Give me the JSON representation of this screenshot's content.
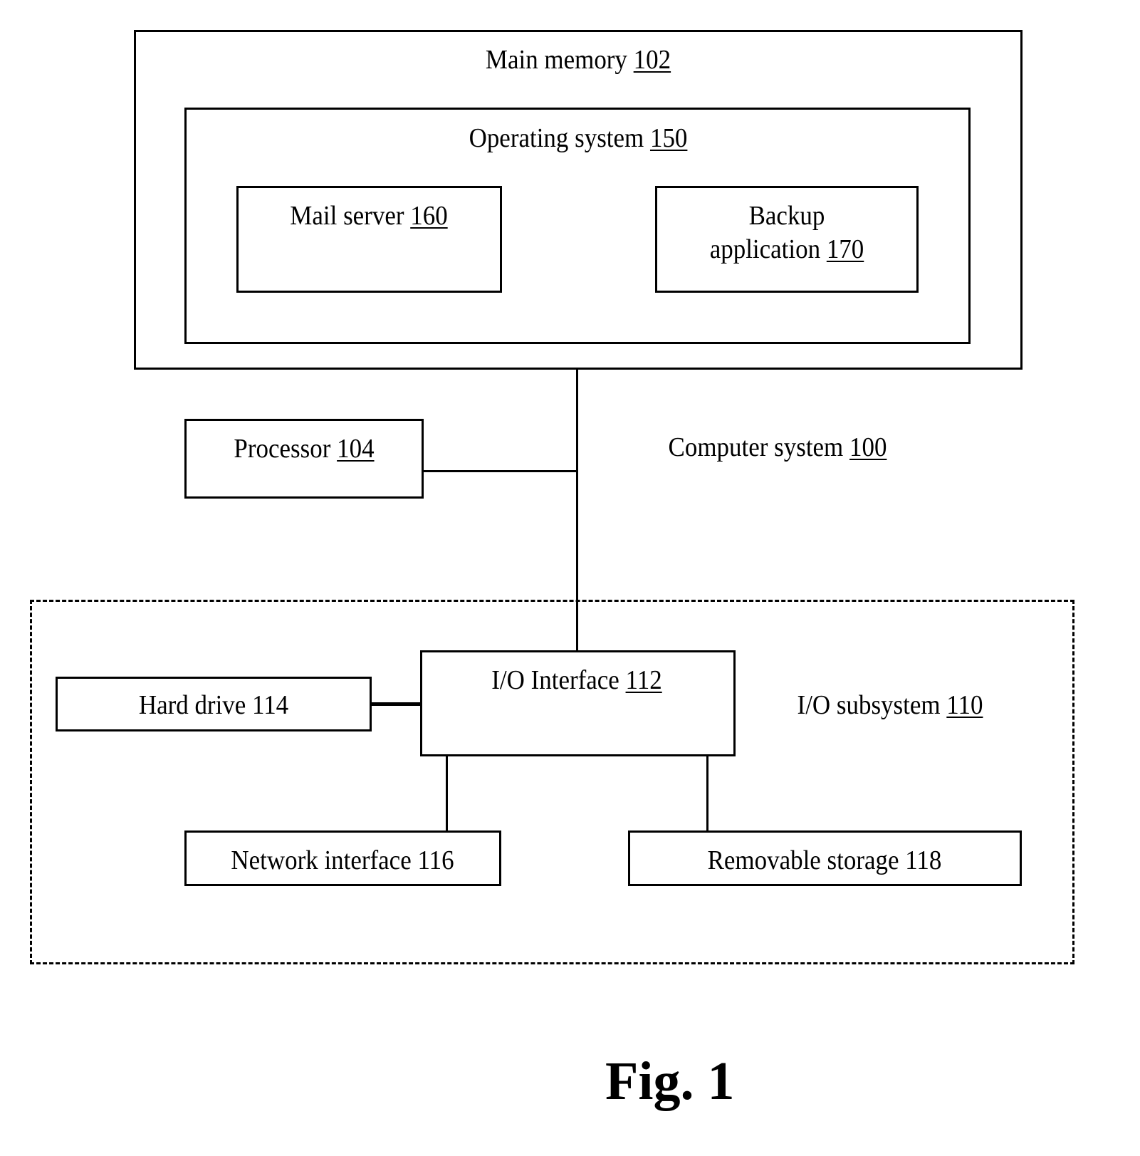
{
  "diagram": {
    "main_memory": {
      "label": "Main memory",
      "ref": "102"
    },
    "operating_system": {
      "label": "Operating system",
      "ref": "150"
    },
    "mail_server": {
      "label": "Mail server",
      "ref": "160"
    },
    "backup_application": {
      "label_line1": "Backup",
      "label_line2": "application",
      "ref": "170"
    },
    "processor": {
      "label": "Processor",
      "ref": "104"
    },
    "computer_system": {
      "label": "Computer system",
      "ref": "100"
    },
    "io_subsystem": {
      "label": "I/O subsystem",
      "ref": "110"
    },
    "io_interface": {
      "label": "I/O Interface",
      "ref": "112"
    },
    "hard_drive": {
      "label": "Hard drive 114"
    },
    "network_interface": {
      "label": "Network interface 116"
    },
    "removable_storage": {
      "label": "Removable storage 118"
    },
    "figure_caption": "Fig. 1"
  }
}
